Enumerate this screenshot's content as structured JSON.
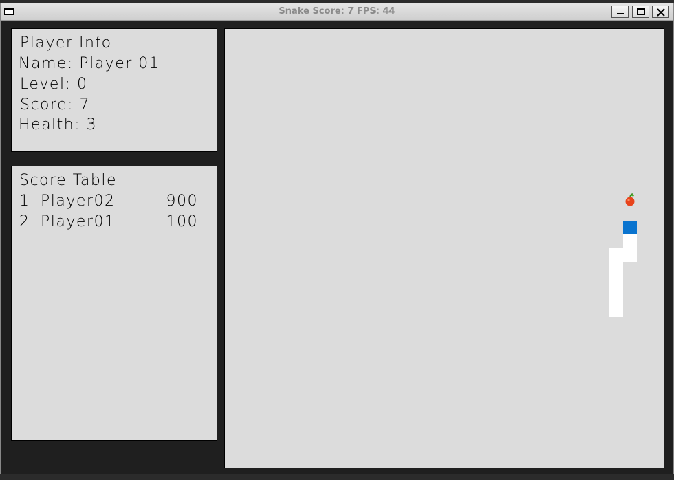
{
  "window": {
    "title": "Snake Score: 7 FPS: 44"
  },
  "player_info": {
    "heading": "Player Info",
    "name_line": "Name: Player 01",
    "level_line": "Level: 0",
    "score_line": "Score: 7",
    "health_line": "Health: 3"
  },
  "score_table": {
    "heading": "Score Table",
    "rows": [
      {
        "rank": "1",
        "name": "Player02",
        "score": "900"
      },
      {
        "rank": "2",
        "name": "Player01",
        "score": "100"
      }
    ]
  },
  "game": {
    "food_icon": "apple-icon",
    "colors": {
      "board": "#dcdcdc",
      "snake_body": "#ffffff",
      "snake_head": "#0a74cf",
      "food": "#e8441c"
    }
  }
}
